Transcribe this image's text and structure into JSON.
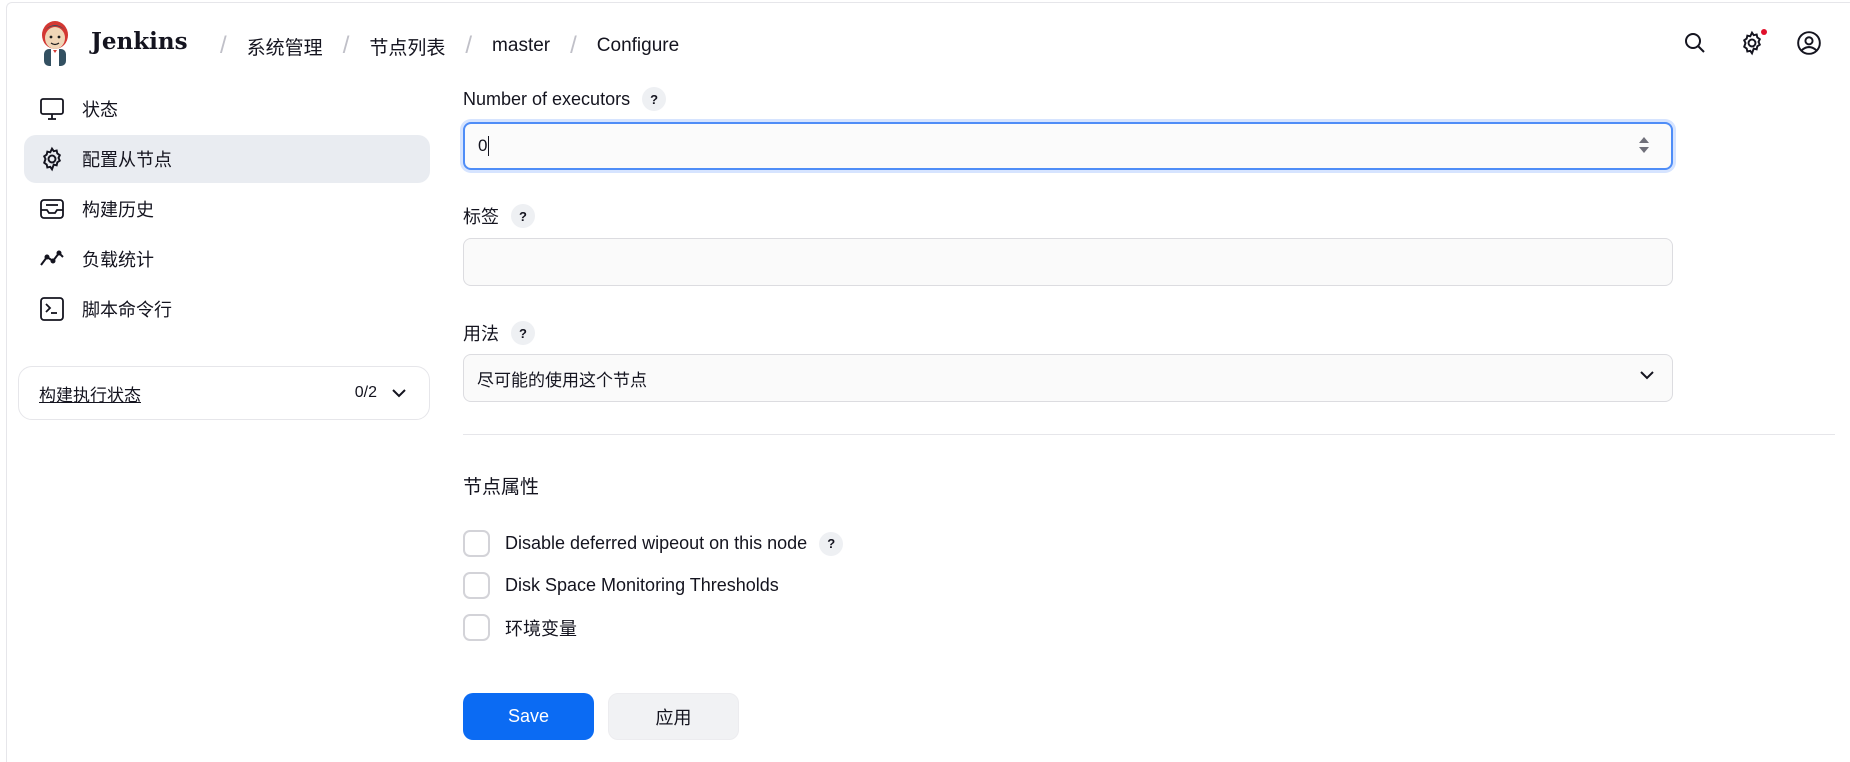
{
  "header": {
    "brand": "Jenkins",
    "breadcrumbs": [
      "系统管理",
      "节点列表",
      "master",
      "Configure"
    ],
    "has_notification": true
  },
  "sidebar": {
    "items": [
      {
        "label": "状态",
        "icon": "monitor-icon",
        "active": false
      },
      {
        "label": "配置从节点",
        "icon": "gear-icon",
        "active": true
      },
      {
        "label": "构建历史",
        "icon": "inbox-icon",
        "active": false
      },
      {
        "label": "负载统计",
        "icon": "trend-line-icon",
        "active": false
      },
      {
        "label": "脚本命令行",
        "icon": "terminal-icon",
        "active": false
      }
    ],
    "executor_status": {
      "title": "构建执行状态",
      "count": "0/2"
    }
  },
  "form": {
    "executors": {
      "label": "Number of executors",
      "value": "0"
    },
    "labels": {
      "label": "标签",
      "value": ""
    },
    "usage": {
      "label": "用法",
      "selected": "尽可能的使用这个节点"
    },
    "node_properties": {
      "title": "节点属性",
      "items": [
        {
          "label": "Disable deferred wipeout on this node",
          "help": true,
          "checked": false
        },
        {
          "label": "Disk Space Monitoring Thresholds",
          "help": false,
          "checked": false
        },
        {
          "label": "环境变量",
          "help": false,
          "checked": false
        }
      ]
    },
    "help_glyph": "?",
    "save_label": "Save",
    "apply_label": "应用"
  },
  "colors": {
    "primary": "#0b6bf3",
    "focus_ring": "#4f8df7",
    "active_item_bg": "#e9ecf1",
    "notification": "#e0102b"
  }
}
